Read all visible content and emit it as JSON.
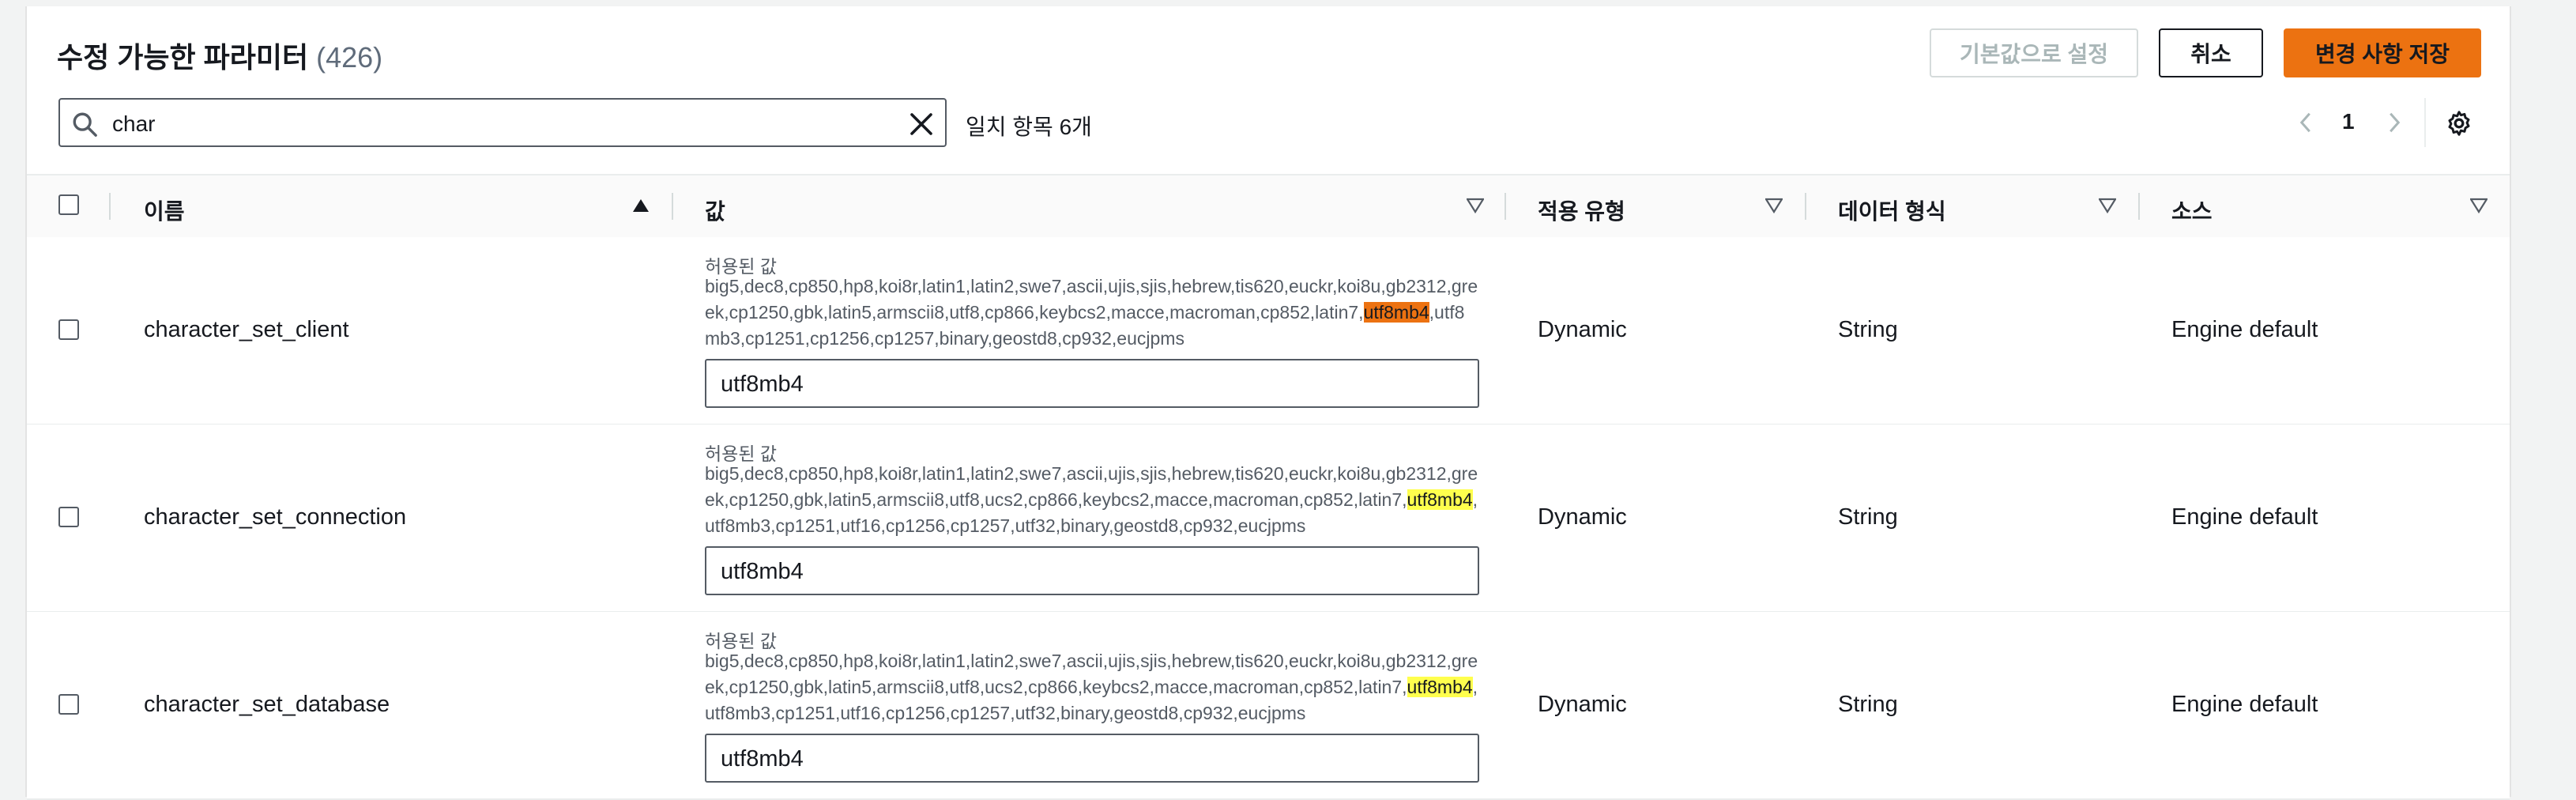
{
  "header": {
    "title": "수정 가능한 파라미터",
    "count": "(426)",
    "reset_label": "기본값으로 설정",
    "cancel_label": "취소",
    "save_label": "변경 사항 저장"
  },
  "search": {
    "value": "char",
    "match_text": "일치 항목 6개"
  },
  "pagination": {
    "current_page": "1"
  },
  "columns": {
    "name": "이름",
    "value": "값",
    "apply_type": "적용 유형",
    "data_type": "데이터 형식",
    "source": "소스"
  },
  "rows": [
    {
      "name": "character_set_client",
      "allowed_label": "허용된 값",
      "allowed_before": "big5,dec8,cp850,hp8,koi8r,latin1,latin2,swe7,ascii,ujis,sjis,hebrew,tis620,euckr,koi8u,gb2312,greek,cp1250,gbk,latin5,armscii8,utf8,cp866,keybcs2,macce,macroman,cp852,latin7,",
      "allowed_match": "utf8mb4",
      "allowed_after": ",utf8mb3,cp1251,cp1256,cp1257,binary,geostd8,cp932,eucjpms",
      "value": "utf8mb4",
      "apply_type": "Dynamic",
      "data_type": "String",
      "source": "Engine default"
    },
    {
      "name": "character_set_connection",
      "allowed_label": "허용된 값",
      "allowed_before": "big5,dec8,cp850,hp8,koi8r,latin1,latin2,swe7,ascii,ujis,sjis,hebrew,tis620,euckr,koi8u,gb2312,greek,cp1250,gbk,latin5,armscii8,utf8,ucs2,cp866,keybcs2,macce,macroman,cp852,latin7,",
      "allowed_match": "utf8mb4",
      "allowed_after": ",utf8mb3,cp1251,utf16,cp1256,cp1257,utf32,binary,geostd8,cp932,eucjpms",
      "value": "utf8mb4",
      "apply_type": "Dynamic",
      "data_type": "String",
      "source": "Engine default"
    },
    {
      "name": "character_set_database",
      "allowed_label": "허용된 값",
      "allowed_before": "big5,dec8,cp850,hp8,koi8r,latin1,latin2,swe7,ascii,ujis,sjis,hebrew,tis620,euckr,koi8u,gb2312,greek,cp1250,gbk,latin5,armscii8,utf8,ucs2,cp866,keybcs2,macce,macroman,cp852,latin7,",
      "allowed_match": "utf8mb4",
      "allowed_after": ",utf8mb3,cp1251,utf16,cp1256,cp1257,utf32,binary,geostd8,cp932,eucjpms",
      "value": "utf8mb4",
      "apply_type": "Dynamic",
      "data_type": "String",
      "source": "Engine default"
    }
  ],
  "colors": {
    "accent": "#ec7211",
    "highlight": "#ffff4d",
    "text": "#16191f",
    "muted": "#545b64"
  }
}
